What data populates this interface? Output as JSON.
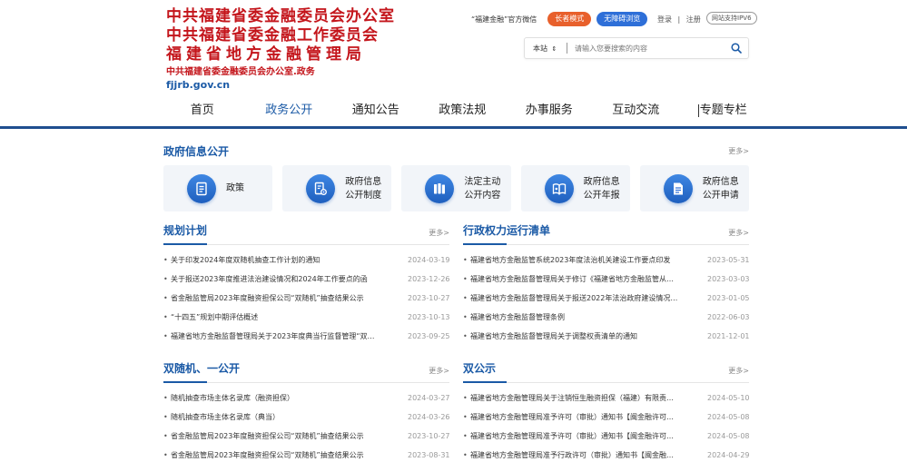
{
  "logo": {
    "line1": "中共福建省委金融委员会办公室",
    "line2": "中共福建省委金融工作委员会",
    "line3": "福建省地方金融管理局",
    "subtitle": "中共福建省委金融委员会办公室.政务",
    "domain": "fjjrb.gov.cn"
  },
  "topbar": {
    "wechat_label": "“福建金融”官方微信",
    "elder_mode_label": "长者模式",
    "accessible_label": "无障碍浏览",
    "login_label": "登录",
    "separator": "|",
    "register_label": "注册",
    "ipv6_label": "网站支持IPV6"
  },
  "search": {
    "scope_value": "本站",
    "placeholder": "请输入您要搜索的内容"
  },
  "nav": {
    "items": [
      "首页",
      "政务公开",
      "通知公告",
      "政策法规",
      "办事服务",
      "互动交流",
      "专题专栏"
    ],
    "active_index": 1
  },
  "colors": {
    "brand_red": "#c4161c",
    "brand_blue": "#1b5aa6",
    "nav_bar": "#1f4f8f",
    "elder_pill": "#e8602c",
    "accessible_pill": "#2e6fd8"
  },
  "gov_info": {
    "title": "政府信息公开",
    "more": "更多>",
    "cards": [
      {
        "label": "政策",
        "icon": "document-icon"
      },
      {
        "label": "政府信息\n公开制度",
        "icon": "document-gear-icon"
      },
      {
        "label": "法定主动\n公开内容",
        "icon": "books-icon"
      },
      {
        "label": "政府信息\n公开年报",
        "icon": "open-book-icon"
      },
      {
        "label": "政府信息\n公开申请",
        "icon": "file-lines-icon"
      }
    ]
  },
  "plan": {
    "title": "规划计划",
    "more": "更多>",
    "items": [
      {
        "title": "关于印发2024年度双随机抽查工作计划的通知",
        "date": "2024-03-19"
      },
      {
        "title": "关于报送2023年度推进法治建设情况和2024年工作要点的函",
        "date": "2023-12-26"
      },
      {
        "title": "省金融监管局2023年度融资担保公司“双随机”抽查结果公示",
        "date": "2023-10-27"
      },
      {
        "title": "“十四五”规划中期评估概述",
        "date": "2023-10-13"
      },
      {
        "title": "福建省地方金融监督管理局关于2023年度典当行监督管理“双…",
        "date": "2023-09-25"
      }
    ]
  },
  "power": {
    "title": "行政权力运行清单",
    "more": "更多>",
    "items": [
      {
        "title": "福建省地方金融监管系统2023年度法治机关建设工作要点印发",
        "date": "2023-05-31"
      },
      {
        "title": "福建省地方金融监督管理局关于修订《福建省地方金融监管从…",
        "date": "2023-03-03"
      },
      {
        "title": "福建省地方金融监督管理局关于报送2022年法治政府建设情况…",
        "date": "2023-01-05"
      },
      {
        "title": "福建省地方金融监督管理条例",
        "date": "2022-06-03"
      },
      {
        "title": "福建省地方金融监督管理局关于调整权责清单的通知",
        "date": "2021-12-01"
      }
    ]
  },
  "random": {
    "title": "双随机、一公开",
    "more": "更多>",
    "items": [
      {
        "title": "随机抽查市场主体名录库（融资担保）",
        "date": "2024-03-27"
      },
      {
        "title": "随机抽查市场主体名录库（典当）",
        "date": "2024-03-26"
      },
      {
        "title": "省金融监管局2023年度融资担保公司“双随机”抽查结果公示",
        "date": "2023-10-27"
      },
      {
        "title": "省金融监管局2023年度融资担保公司“双随机”抽查结果公示",
        "date": "2023-08-31"
      }
    ]
  },
  "public": {
    "title": "双公示",
    "more": "更多>",
    "items": [
      {
        "title": "福建省地方金融管理局关于注销恒生融资担保（福建）有限责…",
        "date": "2024-05-10"
      },
      {
        "title": "福建省地方金融管理局准予许可（审批）通知书【闽金融许可…",
        "date": "2024-05-08"
      },
      {
        "title": "福建省地方金融管理局准予许可（审批）通知书【闽金融许可…",
        "date": "2024-05-08"
      },
      {
        "title": "福建省地方金融管理局准予行政许可（审批）通知书【闽金融…",
        "date": "2024-04-29"
      }
    ]
  },
  "bullet": "•"
}
